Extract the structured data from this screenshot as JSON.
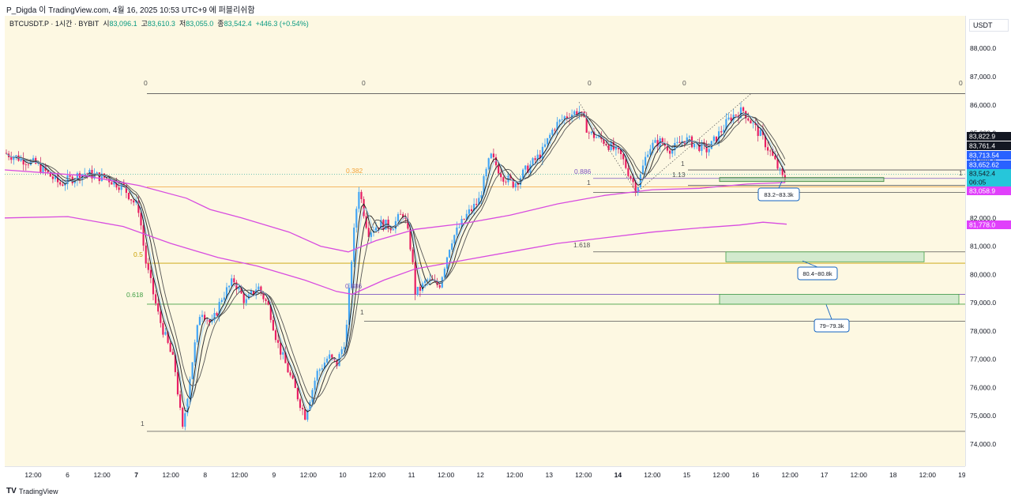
{
  "header": {
    "attribution": "P_Digda 이 TradingView.com, 4월 16, 2025 10:53 UTC+9 에 퍼블리쉬함"
  },
  "symbol": {
    "name": "BTCUSDT.P · 1시간 · BYBIT",
    "o_label": "시",
    "o_val": "83,096.1",
    "h_label": "고",
    "h_val": "83,610.3",
    "l_label": "저",
    "l_val": "83,055.0",
    "c_label": "종",
    "c_val": "83,542.4",
    "change": "+446.3 (+0.54%)"
  },
  "currency": "USDT",
  "footer": {
    "brand": "TradingView"
  },
  "chart_data": {
    "type": "candlestick",
    "price_ticks": [
      "88,000.0",
      "87,000.0",
      "86,000.0",
      "85,000.0",
      "84,000.0",
      "83,000.0",
      "82,000.0",
      "81,000.0",
      "80,000.0",
      "79,000.0",
      "78,000.0",
      "77,000.0",
      "76,000.0",
      "75,000.0",
      "74,000.0"
    ],
    "price_tick_values": [
      88000,
      87000,
      86000,
      85000,
      84000,
      83000,
      82000,
      81000,
      80000,
      79000,
      78000,
      77000,
      76000,
      75000,
      74000
    ],
    "ylim": [
      73300,
      89500
    ],
    "time_labels": [
      "12:00",
      "6",
      "12:00",
      "7",
      "12:00",
      "8",
      "12:00",
      "9",
      "12:00",
      "10",
      "12:00",
      "11",
      "12:00",
      "12",
      "12:00",
      "13",
      "12:00",
      "14",
      "12:00",
      "15",
      "12:00",
      "16",
      "12:00",
      "17",
      "12:00",
      "18",
      "12:00",
      "19"
    ],
    "time_bold": [
      false,
      false,
      false,
      true,
      false,
      false,
      false,
      false,
      false,
      false,
      false,
      false,
      false,
      false,
      false,
      false,
      false,
      true,
      false,
      false,
      false,
      false,
      false,
      false,
      false,
      false,
      false,
      false
    ],
    "price_tags": [
      {
        "label": "83,822.9",
        "value": 83822.9,
        "color": "#131722",
        "text": "#ffffff"
      },
      {
        "label": "83,761.4",
        "value": 83761.4,
        "color": "#131722",
        "text": "#ffffff"
      },
      {
        "label": "83,713.54",
        "value": 83713.54,
        "color": "#2962ff",
        "text": "#ffffff"
      },
      {
        "label": "83,652.62",
        "value": 83652.62,
        "color": "#2962ff",
        "text": "#ffffff"
      },
      {
        "label": "83,542.4",
        "value": 83542.4,
        "color": "#26c6da",
        "text": "#131722"
      },
      {
        "label": "06:05",
        "value": 83370,
        "color": "#26c6da",
        "text": "#131722"
      },
      {
        "label": "83,058.9",
        "value": 83058.9,
        "color": "#e040fb",
        "text": "#ffffff"
      },
      {
        "label": "81,778.0",
        "value": 81778.0,
        "color": "#e040fb",
        "text": "#ffffff"
      }
    ],
    "fib_labels": [
      {
        "text": "0",
        "color": "#555555"
      },
      {
        "text": "0",
        "color": "#555555"
      },
      {
        "text": "0",
        "color": "#555555"
      },
      {
        "text": "0",
        "color": "#555555"
      },
      {
        "text": "0",
        "color": "#555555"
      },
      {
        "text": "0.382",
        "color": "#f2a33a"
      },
      {
        "text": "0.5",
        "color": "#c8a000"
      },
      {
        "text": "0.618",
        "color": "#43a047"
      },
      {
        "text": "1",
        "color": "#555555"
      },
      {
        "text": "0.886",
        "color": "#7e57c2"
      },
      {
        "text": "1",
        "color": "#555555"
      },
      {
        "text": "0.886",
        "color": "#7e57c2"
      },
      {
        "text": "1",
        "color": "#555555"
      },
      {
        "text": "1.618",
        "color": "#555555"
      },
      {
        "text": "1",
        "color": "#555555"
      },
      {
        "text": "1.13",
        "color": "#555555"
      },
      {
        "text": "1",
        "color": "#555555"
      }
    ],
    "callouts": [
      {
        "text": "83.2~83.3k"
      },
      {
        "text": "80.4~80.8k"
      },
      {
        "text": "79~79.3k"
      }
    ]
  }
}
